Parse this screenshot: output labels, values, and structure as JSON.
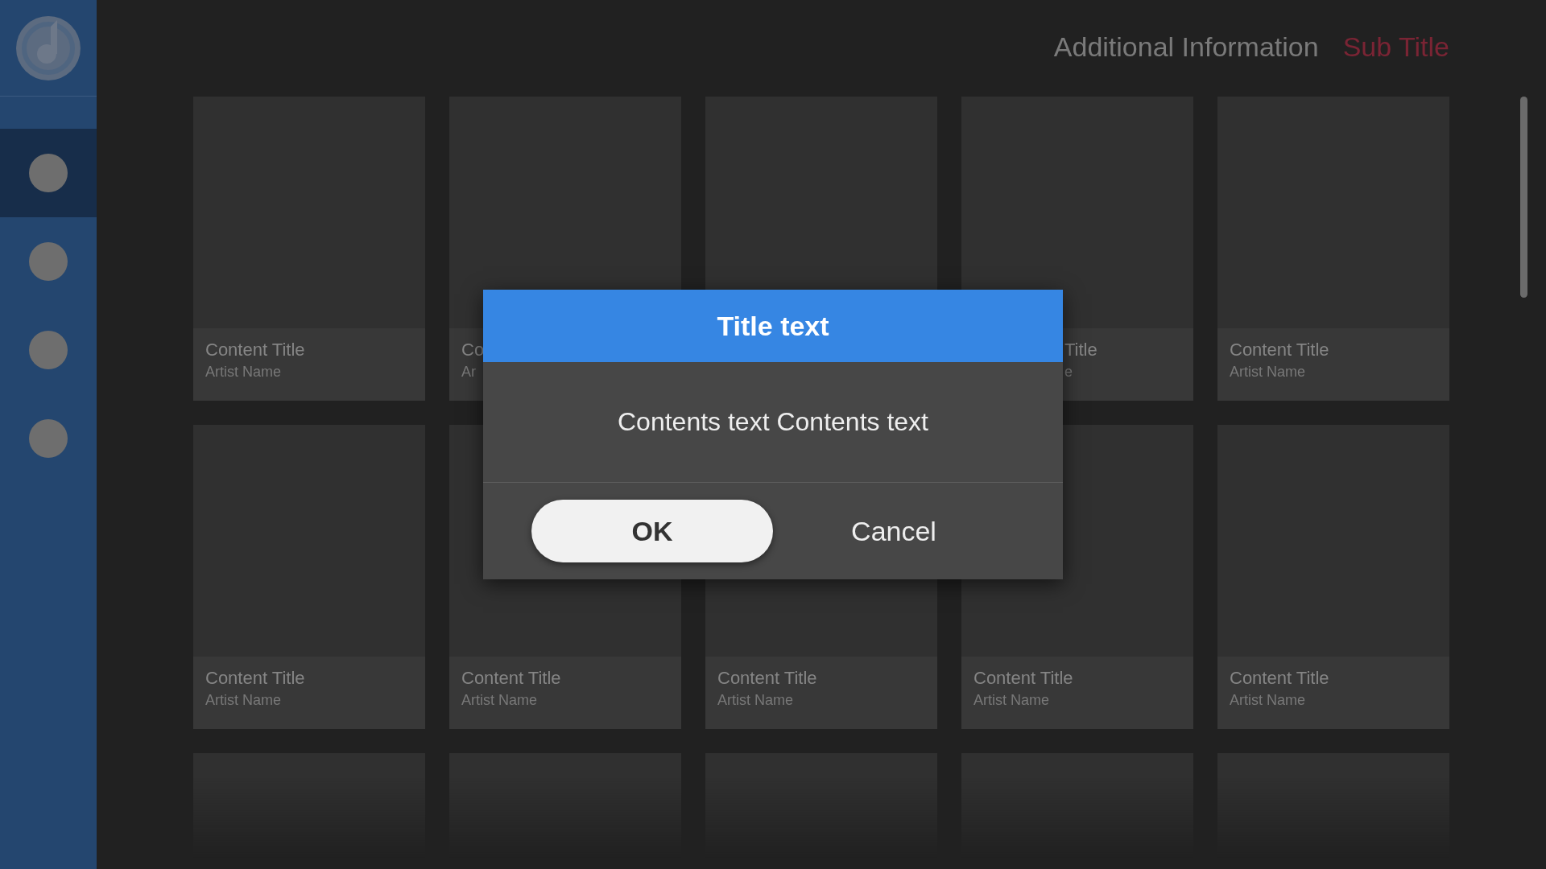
{
  "sidebar": {
    "items": [
      {
        "selected": true
      },
      {
        "selected": false
      },
      {
        "selected": false
      },
      {
        "selected": false
      }
    ]
  },
  "header": {
    "info": "Additional Information",
    "subtitle": "Sub Title"
  },
  "cards": [
    {
      "kind": "full",
      "title": "Content Title",
      "artist": "Artist Name"
    },
    {
      "kind": "full",
      "title": "Co",
      "artist": "Ar"
    },
    {
      "kind": "full"
    },
    {
      "kind": "partial_right",
      "title": "Title",
      "artist": "e"
    },
    {
      "kind": "full",
      "title": "Content Title",
      "artist": "Artist Name"
    },
    {
      "kind": "full",
      "title": "Content Title",
      "artist": "Artist Name"
    },
    {
      "kind": "full",
      "title": "Content Title",
      "artist": "Artist Name"
    },
    {
      "kind": "full",
      "title": "Content Title",
      "artist": "Artist Name"
    },
    {
      "kind": "full",
      "title": "Content Title",
      "artist": "Artist Name"
    },
    {
      "kind": "full",
      "title": "Content Title",
      "artist": "Artist Name"
    },
    {
      "kind": "faded"
    },
    {
      "kind": "faded"
    },
    {
      "kind": "faded"
    },
    {
      "kind": "faded"
    },
    {
      "kind": "faded"
    }
  ],
  "dialog": {
    "title": "Title text",
    "message": "Contents text Contents text",
    "buttons": [
      {
        "label": "OK",
        "kind": "primary"
      },
      {
        "label": "Cancel",
        "kind": "text"
      }
    ]
  }
}
